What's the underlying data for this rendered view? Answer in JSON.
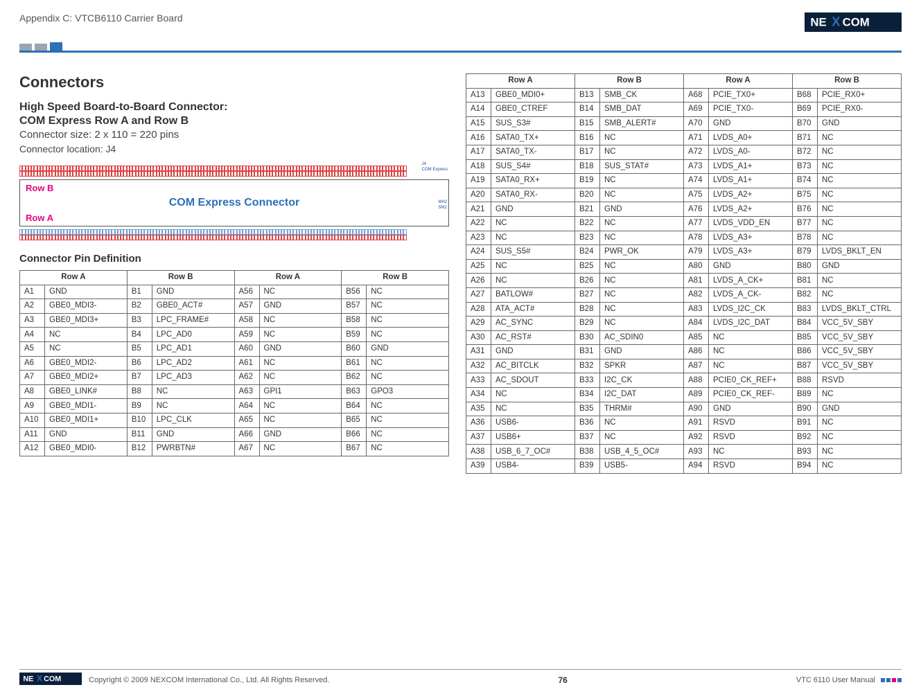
{
  "header": {
    "appendix": "Appendix C: VTCB6110 Carrier Board",
    "logo_text": "NEXCOM"
  },
  "left": {
    "h1": "Connectors",
    "h2a": "High Speed Board-to-Board Connector:",
    "h2b": "COM Express Row A and Row B",
    "size": "Connector size: 2 x 110 = 220 pins",
    "loc": "Connector location: J4",
    "diagram": {
      "rowb": "Row B",
      "rowa": "Row A",
      "conn": "COM Express Connector",
      "j4": "J4",
      "com": "COM Express",
      "md2": "MH2",
      "sm1": "SM1"
    },
    "pindef_title": "Connector Pin Definition"
  },
  "cols": {
    "rowA": "Row A",
    "rowB": "Row B"
  },
  "table1": [
    {
      "a1p": "A1",
      "a1s": "GND",
      "b1p": "B1",
      "b1s": "GND",
      "a2p": "A56",
      "a2s": "NC",
      "b2p": "B56",
      "b2s": "NC"
    },
    {
      "a1p": "A2",
      "a1s": "GBE0_MDI3-",
      "b1p": "B2",
      "b1s": "GBE0_ACT#",
      "a2p": "A57",
      "a2s": "GND",
      "b2p": "B57",
      "b2s": "NC"
    },
    {
      "a1p": "A3",
      "a1s": "GBE0_MDI3+",
      "b1p": "B3",
      "b1s": "LPC_FRAME#",
      "a2p": "A58",
      "a2s": "NC",
      "b2p": "B58",
      "b2s": "NC"
    },
    {
      "a1p": "A4",
      "a1s": "NC",
      "b1p": "B4",
      "b1s": "LPC_AD0",
      "a2p": "A59",
      "a2s": "NC",
      "b2p": "B59",
      "b2s": "NC"
    },
    {
      "a1p": "A5",
      "a1s": "NC",
      "b1p": "B5",
      "b1s": "LPC_AD1",
      "a2p": "A60",
      "a2s": "GND",
      "b2p": "B60",
      "b2s": "GND"
    },
    {
      "a1p": "A6",
      "a1s": "GBE0_MDI2-",
      "b1p": "B6",
      "b1s": "LPC_AD2",
      "a2p": "A61",
      "a2s": "NC",
      "b2p": "B61",
      "b2s": "NC"
    },
    {
      "a1p": "A7",
      "a1s": "GBE0_MDI2+",
      "b1p": "B7",
      "b1s": "LPC_AD3",
      "a2p": "A62",
      "a2s": "NC",
      "b2p": "B62",
      "b2s": "NC"
    },
    {
      "a1p": "A8",
      "a1s": "GBE0_LINK#",
      "b1p": "B8",
      "b1s": "NC",
      "a2p": "A63",
      "a2s": "GPI1",
      "b2p": "B63",
      "b2s": "GPO3"
    },
    {
      "a1p": "A9",
      "a1s": "GBE0_MDI1-",
      "b1p": "B9",
      "b1s": "NC",
      "a2p": "A64",
      "a2s": "NC",
      "b2p": "B64",
      "b2s": "NC"
    },
    {
      "a1p": "A10",
      "a1s": "GBE0_MDI1+",
      "b1p": "B10",
      "b1s": "LPC_CLK",
      "a2p": "A65",
      "a2s": "NC",
      "b2p": "B65",
      "b2s": "NC"
    },
    {
      "a1p": "A11",
      "a1s": "GND",
      "b1p": "B11",
      "b1s": "GND",
      "a2p": "A66",
      "a2s": "GND",
      "b2p": "B66",
      "b2s": "NC"
    },
    {
      "a1p": "A12",
      "a1s": "GBE0_MDI0-",
      "b1p": "B12",
      "b1s": "PWRBTN#",
      "a2p": "A67",
      "a2s": "NC",
      "b2p": "B67",
      "b2s": "NC"
    }
  ],
  "table2": [
    {
      "a1p": "A13",
      "a1s": "GBE0_MDI0+",
      "b1p": "B13",
      "b1s": "SMB_CK",
      "a2p": "A68",
      "a2s": "PCIE_TX0+",
      "b2p": "B68",
      "b2s": "PCIE_RX0+"
    },
    {
      "a1p": "A14",
      "a1s": "GBE0_CTREF",
      "b1p": "B14",
      "b1s": "SMB_DAT",
      "a2p": "A69",
      "a2s": "PCIE_TX0-",
      "b2p": "B69",
      "b2s": "PCIE_RX0-"
    },
    {
      "a1p": "A15",
      "a1s": "SUS_S3#",
      "b1p": "B15",
      "b1s": "SMB_ALERT#",
      "a2p": "A70",
      "a2s": "GND",
      "b2p": "B70",
      "b2s": "GND"
    },
    {
      "a1p": "A16",
      "a1s": "SATA0_TX+",
      "b1p": "B16",
      "b1s": "NC",
      "a2p": "A71",
      "a2s": "LVDS_A0+",
      "b2p": "B71",
      "b2s": "NC"
    },
    {
      "a1p": "A17",
      "a1s": "SATA0_TX-",
      "b1p": "B17",
      "b1s": "NC",
      "a2p": "A72",
      "a2s": "LVDS_A0-",
      "b2p": "B72",
      "b2s": "NC"
    },
    {
      "a1p": "A18",
      "a1s": "SUS_S4#",
      "b1p": "B18",
      "b1s": "SUS_STAT#",
      "a2p": "A73",
      "a2s": "LVDS_A1+",
      "b2p": "B73",
      "b2s": "NC"
    },
    {
      "a1p": "A19",
      "a1s": "SATA0_RX+",
      "b1p": "B19",
      "b1s": "NC",
      "a2p": "A74",
      "a2s": "LVDS_A1+",
      "b2p": "B74",
      "b2s": "NC"
    },
    {
      "a1p": "A20",
      "a1s": "SATA0_RX-",
      "b1p": "B20",
      "b1s": "NC",
      "a2p": "A75",
      "a2s": "LVDS_A2+",
      "b2p": "B75",
      "b2s": "NC"
    },
    {
      "a1p": "A21",
      "a1s": "GND",
      "b1p": "B21",
      "b1s": "GND",
      "a2p": "A76",
      "a2s": "LVDS_A2+",
      "b2p": "B76",
      "b2s": "NC"
    },
    {
      "a1p": "A22",
      "a1s": "NC",
      "b1p": "B22",
      "b1s": "NC",
      "a2p": "A77",
      "a2s": "LVDS_VDD_EN",
      "b2p": "B77",
      "b2s": "NC"
    },
    {
      "a1p": "A23",
      "a1s": "NC",
      "b1p": "B23",
      "b1s": "NC",
      "a2p": "A78",
      "a2s": "LVDS_A3+",
      "b2p": "B78",
      "b2s": "NC"
    },
    {
      "a1p": "A24",
      "a1s": "SUS_S5#",
      "b1p": "B24",
      "b1s": "PWR_OK",
      "a2p": "A79",
      "a2s": "LVDS_A3+",
      "b2p": "B79",
      "b2s": "LVDS_BKLT_EN"
    },
    {
      "a1p": "A25",
      "a1s": "NC",
      "b1p": "B25",
      "b1s": "NC",
      "a2p": "A80",
      "a2s": "GND",
      "b2p": "B80",
      "b2s": "GND"
    },
    {
      "a1p": "A26",
      "a1s": "NC",
      "b1p": "B26",
      "b1s": "NC",
      "a2p": "A81",
      "a2s": "LVDS_A_CK+",
      "b2p": "B81",
      "b2s": "NC"
    },
    {
      "a1p": "A27",
      "a1s": "BATLOW#",
      "b1p": "B27",
      "b1s": "NC",
      "a2p": "A82",
      "a2s": "LVDS_A_CK-",
      "b2p": "B82",
      "b2s": "NC"
    },
    {
      "a1p": "A28",
      "a1s": "ATA_ACT#",
      "b1p": "B28",
      "b1s": "NC",
      "a2p": "A83",
      "a2s": "LVDS_I2C_CK",
      "b2p": "B83",
      "b2s": "LVDS_BKLT_CTRL"
    },
    {
      "a1p": "A29",
      "a1s": "AC_SYNC",
      "b1p": "B29",
      "b1s": "NC",
      "a2p": "A84",
      "a2s": "LVDS_I2C_DAT",
      "b2p": "B84",
      "b2s": "VCC_5V_SBY"
    },
    {
      "a1p": "A30",
      "a1s": "AC_RST#",
      "b1p": "B30",
      "b1s": "AC_SDIN0",
      "a2p": "A85",
      "a2s": "NC",
      "b2p": "B85",
      "b2s": "VCC_5V_SBY"
    },
    {
      "a1p": "A31",
      "a1s": "GND",
      "b1p": "B31",
      "b1s": "GND",
      "a2p": "A86",
      "a2s": "NC",
      "b2p": "B86",
      "b2s": "VCC_5V_SBY"
    },
    {
      "a1p": "A32",
      "a1s": "AC_BITCLK",
      "b1p": "B32",
      "b1s": "SPKR",
      "a2p": "A87",
      "a2s": "NC",
      "b2p": "B87",
      "b2s": "VCC_5V_SBY"
    },
    {
      "a1p": "A33",
      "a1s": "AC_SDOUT",
      "b1p": "B33",
      "b1s": "I2C_CK",
      "a2p": "A88",
      "a2s": "PCIE0_CK_REF+",
      "b2p": "B88",
      "b2s": "RSVD"
    },
    {
      "a1p": "A34",
      "a1s": "NC",
      "b1p": "B34",
      "b1s": "I2C_DAT",
      "a2p": "A89",
      "a2s": "PCIE0_CK_REF-",
      "b2p": "B89",
      "b2s": "NC"
    },
    {
      "a1p": "A35",
      "a1s": "NC",
      "b1p": "B35",
      "b1s": "THRM#",
      "a2p": "A90",
      "a2s": "GND",
      "b2p": "B90",
      "b2s": "GND"
    },
    {
      "a1p": "A36",
      "a1s": "USB6-",
      "b1p": "B36",
      "b1s": "NC",
      "a2p": "A91",
      "a2s": "RSVD",
      "b2p": "B91",
      "b2s": "NC"
    },
    {
      "a1p": "A37",
      "a1s": "USB6+",
      "b1p": "B37",
      "b1s": "NC",
      "a2p": "A92",
      "a2s": "RSVD",
      "b2p": "B92",
      "b2s": "NC"
    },
    {
      "a1p": "A38",
      "a1s": "USB_6_7_OC#",
      "b1p": "B38",
      "b1s": "USB_4_5_OC#",
      "a2p": "A93",
      "a2s": "NC",
      "b2p": "B93",
      "b2s": "NC"
    },
    {
      "a1p": "A39",
      "a1s": "USB4-",
      "b1p": "B39",
      "b1s": "USB5-",
      "a2p": "A94",
      "a2s": "RSVD",
      "b2p": "B94",
      "b2s": "NC"
    }
  ],
  "footer": {
    "copyright": "Copyright © 2009 NEXCOM International Co., Ltd. All Rights Reserved.",
    "page": "76",
    "manual": "VTC 6110 User Manual"
  }
}
